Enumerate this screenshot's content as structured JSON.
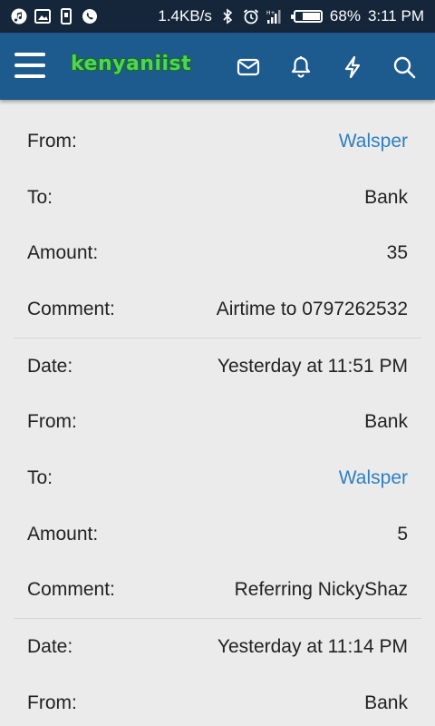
{
  "status_bar": {
    "net_speed": "1.4KB/s",
    "battery": "68%",
    "battery_level": 0.68,
    "time": "3:11 PM"
  },
  "header": {
    "logo_text": "kenyaniist"
  },
  "transactions": [
    {
      "rows": [
        {
          "label": "From:",
          "value": "Walsper",
          "link": true
        },
        {
          "label": "To:",
          "value": "Bank",
          "link": false
        },
        {
          "label": "Amount:",
          "value": "35",
          "link": false
        },
        {
          "label": "Comment:",
          "value": "Airtime to 0797262532",
          "link": false
        }
      ]
    },
    {
      "rows": [
        {
          "label": "Date:",
          "value": "Yesterday at 11:51 PM",
          "link": false
        },
        {
          "label": "From:",
          "value": "Bank",
          "link": false
        },
        {
          "label": "To:",
          "value": "Walsper",
          "link": true
        },
        {
          "label": "Amount:",
          "value": "5",
          "link": false
        },
        {
          "label": "Comment:",
          "value": "Referring NickyShaz",
          "link": false
        }
      ]
    },
    {
      "rows": [
        {
          "label": "Date:",
          "value": "Yesterday at 11:14 PM",
          "link": false
        },
        {
          "label": "From:",
          "value": "Bank",
          "link": false
        }
      ]
    }
  ],
  "colors": {
    "status_bar": "#16263a",
    "app_bar": "#1d5a8e",
    "link": "#2f7fc1",
    "background": "#ebebeb"
  }
}
